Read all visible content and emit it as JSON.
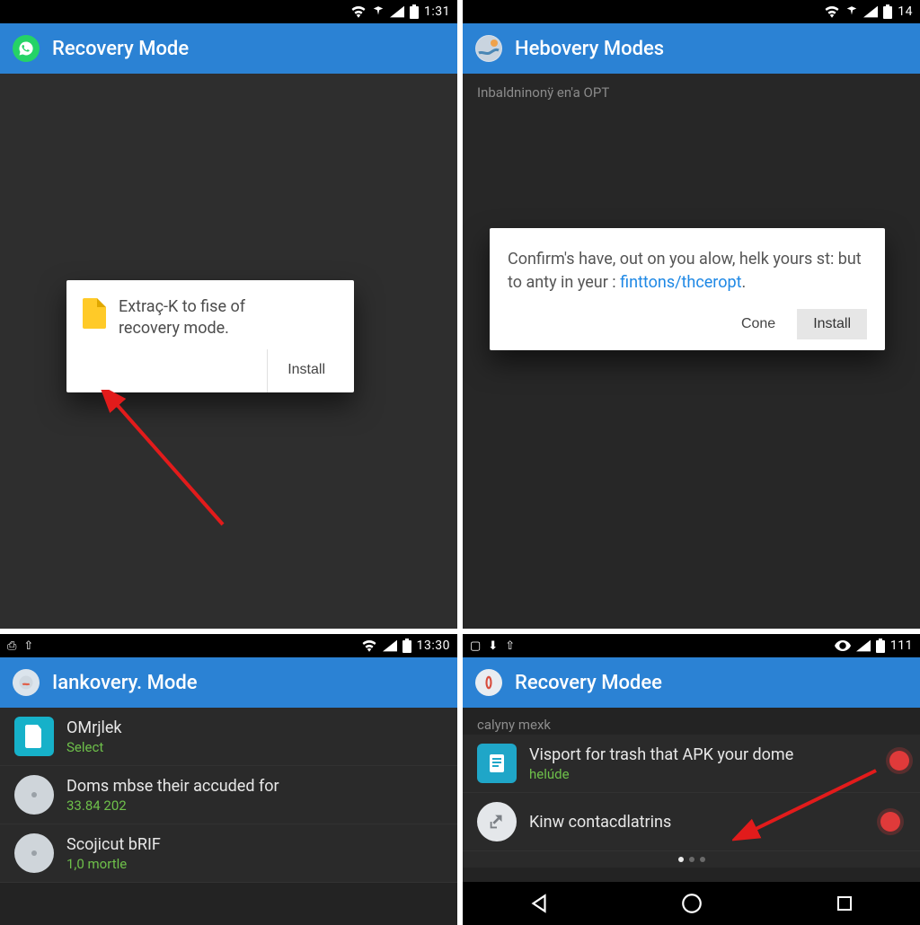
{
  "screens": {
    "s1": {
      "statusbar": {
        "time": "1:31"
      },
      "appbar": {
        "title": "Recovery Mode"
      },
      "dialog": {
        "text_line1": "Extraç-K to fise of",
        "text_line2": "recovery mode.",
        "install": "Install"
      }
    },
    "s2": {
      "statusbar": {
        "time": "14"
      },
      "appbar": {
        "title": "Hebovery Modes"
      },
      "subtitle": "Inbaldninonÿ en'a OPT",
      "dialog": {
        "text_part1": "Confirm's have, out on you alow, helk yours st: but to anty in yeur : ",
        "link": "finttons/thceropt",
        "text_part2": ".",
        "cancel": "Cone",
        "install": "Install"
      }
    },
    "s3": {
      "statusbar": {
        "time": "13:30"
      },
      "appbar": {
        "title": "Iankovery. Mode"
      },
      "items": [
        {
          "title": "OMrjlek",
          "sub": "Select"
        },
        {
          "title": "Doms mbse their accuded for",
          "sub": "33.84 202"
        },
        {
          "title": "Scojicut bRIF",
          "sub": "1,0 mortle"
        }
      ]
    },
    "s4": {
      "statusbar": {
        "time": "111"
      },
      "appbar": {
        "title": "Recovery  Modee"
      },
      "caption": "calyny mexk",
      "items": [
        {
          "title": "Visport for trash that APK your dome",
          "sub": "helúde"
        },
        {
          "title": "Kinw contacdlatrins",
          "sub": ""
        }
      ]
    }
  }
}
